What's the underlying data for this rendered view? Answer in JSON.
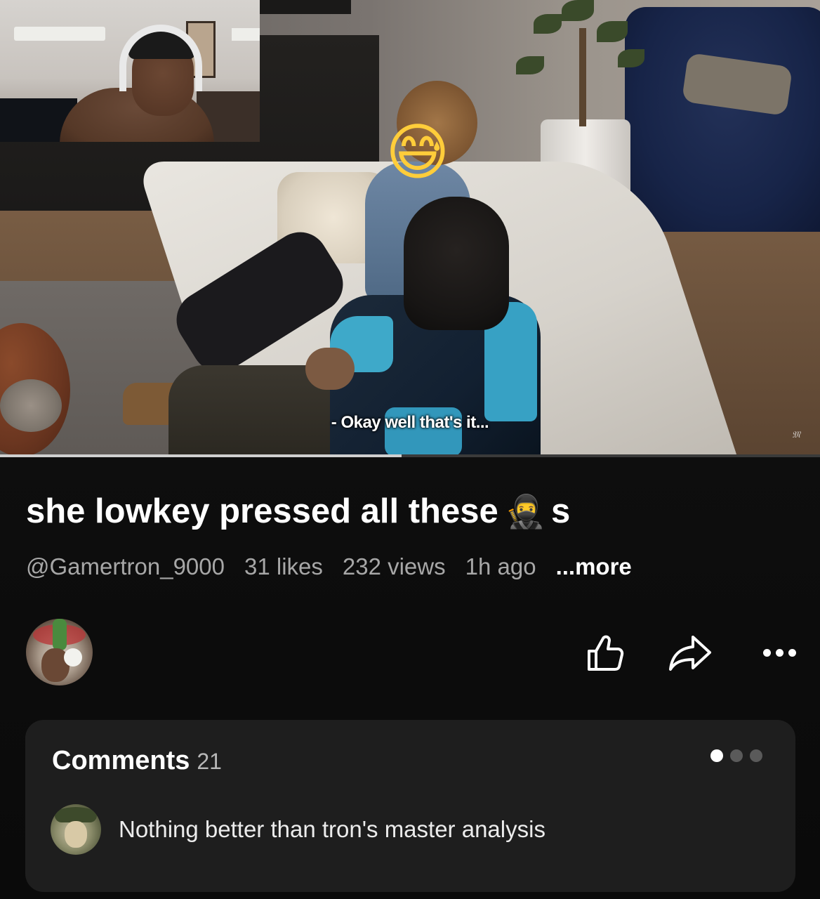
{
  "video": {
    "subtitle": "- Okay well that's it...",
    "progress": 0.49,
    "watermark": "𝔐"
  },
  "post": {
    "title_text": "she lowkey pressed all these",
    "title_emoji": "🥷",
    "title_suffix": "s",
    "author": "@Gamertron_9000",
    "likes": "31 likes",
    "views": "232 views",
    "time": "1h ago",
    "more_label": "...more"
  },
  "actions": {
    "like_icon": "thumbs-up-icon",
    "share_icon": "share-arrow-icon",
    "more_icon": "more-horizontal-icon"
  },
  "comments": {
    "title": "Comments",
    "count": "21",
    "pager_total": 3,
    "pager_active": 0,
    "top_comment": {
      "text": "Nothing better than tron's master analysis"
    }
  },
  "colors": {
    "background": "#0c0c0c",
    "panel": "#1e1e1e",
    "meta_text": "#a7a7a7"
  }
}
